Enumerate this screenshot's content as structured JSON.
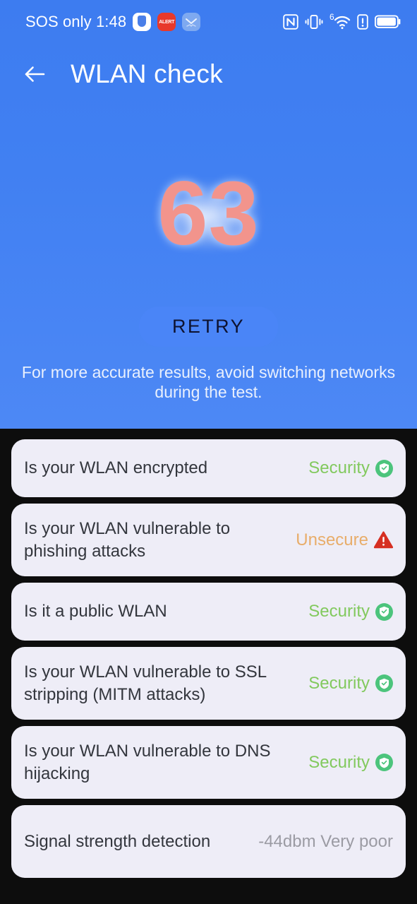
{
  "statusbar": {
    "carrier_time": "SOS only 1:48",
    "left_icons": [
      "shield-app-icon",
      "alert-app-icon",
      "mail-app-icon"
    ],
    "right_icons": [
      "nfc-icon",
      "vibrate-icon",
      "wifi6-icon",
      "alert-icon",
      "battery-icon"
    ],
    "wifi_generation": "6"
  },
  "header": {
    "back_icon": "back-arrow-icon",
    "title": "WLAN check"
  },
  "hero": {
    "score": "63",
    "retry_label": "RETRY",
    "hint": "For more accurate results, avoid switching networks during the test."
  },
  "colors": {
    "hero_blue": "#4180f2",
    "score_salmon": "#f2948c",
    "secure_green": "#82c95e",
    "badge_green": "#4cc47c",
    "unsecure_orange": "#e8ad6a",
    "warn_red": "#d62f22",
    "card_bg": "#eeedf7",
    "page_bg": "#0d0d0d"
  },
  "checks": [
    {
      "label": "Is your WLAN encrypted",
      "status": "Security",
      "status_kind": "secure",
      "icon": "shield-check-icon",
      "two_line": false
    },
    {
      "label": "Is your WLAN vulnerable to phishing attacks",
      "status": "Unsecure",
      "status_kind": "unsecure",
      "icon": "warning-triangle-icon",
      "two_line": true
    },
    {
      "label": "Is it a public WLAN",
      "status": "Security",
      "status_kind": "secure",
      "icon": "shield-check-icon",
      "two_line": false
    },
    {
      "label": "Is your WLAN vulnerable to SSL stripping (MITM attacks)",
      "status": "Security",
      "status_kind": "secure",
      "icon": "shield-check-icon",
      "two_line": true
    },
    {
      "label": "Is your WLAN vulnerable to DNS hijacking",
      "status": "Security",
      "status_kind": "secure",
      "icon": "shield-check-icon",
      "two_line": true
    },
    {
      "label": "Signal strength detection",
      "status": "-44dbm Very poor",
      "status_kind": "plain",
      "icon": "none",
      "two_line": true
    }
  ]
}
